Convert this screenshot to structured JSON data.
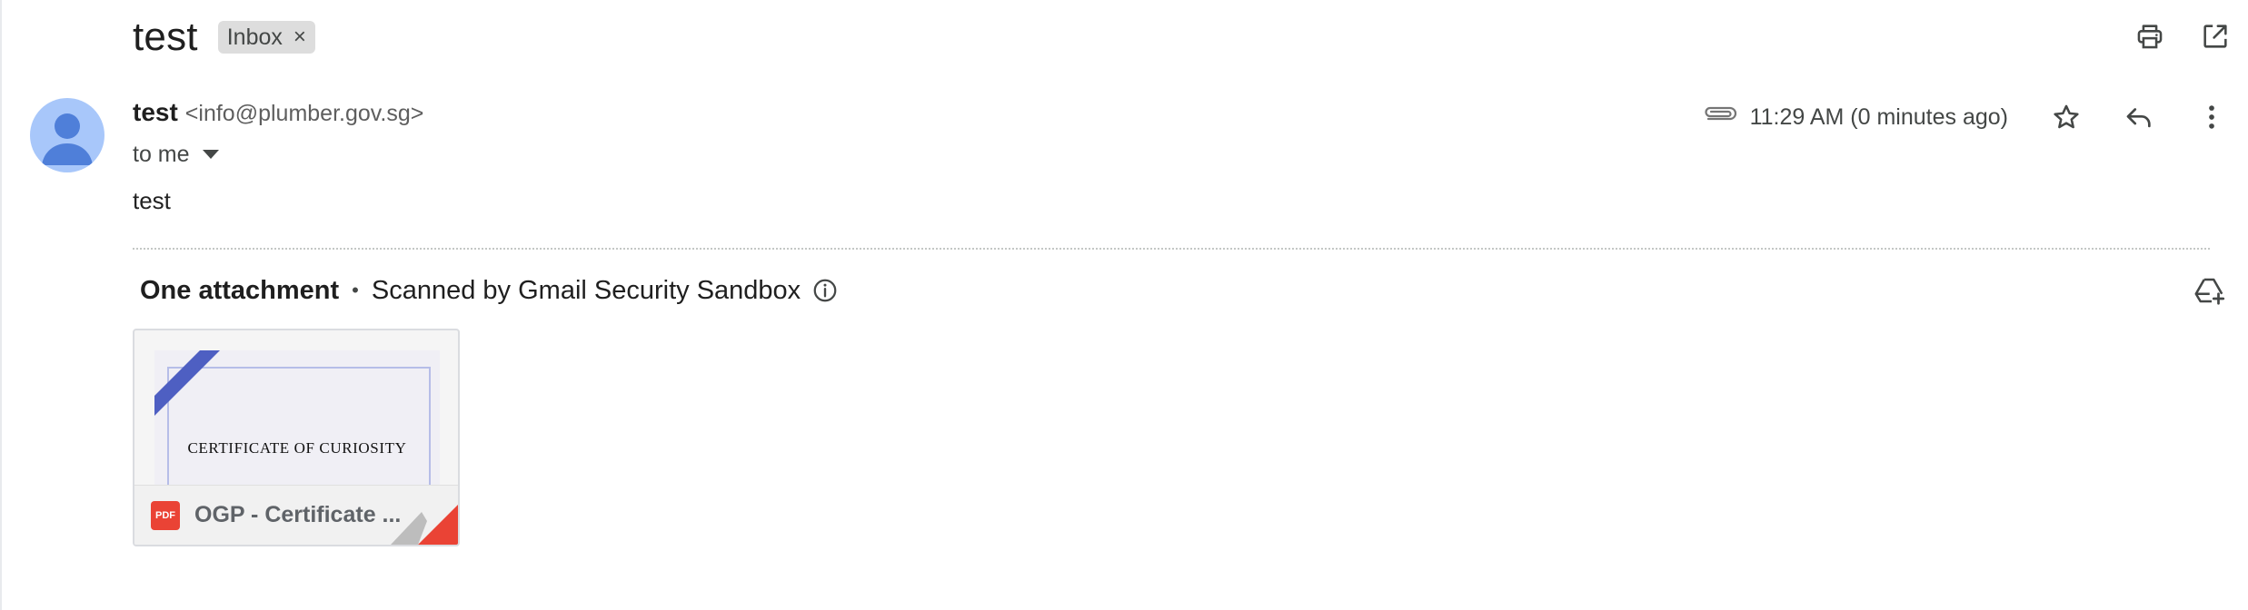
{
  "subject": "test",
  "label_chip": {
    "text": "Inbox",
    "remove": "×"
  },
  "sender": {
    "name": "test",
    "email": "<info@plumber.gov.sg>",
    "to": "to me"
  },
  "meta": {
    "time": "11:29 AM (0 minutes ago)"
  },
  "body": {
    "text": "test"
  },
  "attachments": {
    "count_label": "One attachment",
    "bullet": "•",
    "scan_label": "Scanned by Gmail Security Sandbox",
    "items": [
      {
        "preview_title": "CERTIFICATE OF CURIOSITY",
        "type_badge": "PDF",
        "file_name": "OGP - Certificate ..."
      }
    ]
  },
  "icons": {
    "print": "printer-icon",
    "open_new": "open-in-new-window-icon",
    "attachment": "paperclip-icon",
    "star": "star-icon",
    "reply": "reply-icon",
    "more": "more-vert-icon",
    "info": "info-icon",
    "drive": "add-to-drive-icon"
  },
  "colors": {
    "avatar_bg": "#a8c7fa",
    "avatar_fg": "#4f7fd9",
    "chip_bg": "#dddddd",
    "pdf_red": "#ea4335",
    "ribbon": "#4e5fc2"
  }
}
